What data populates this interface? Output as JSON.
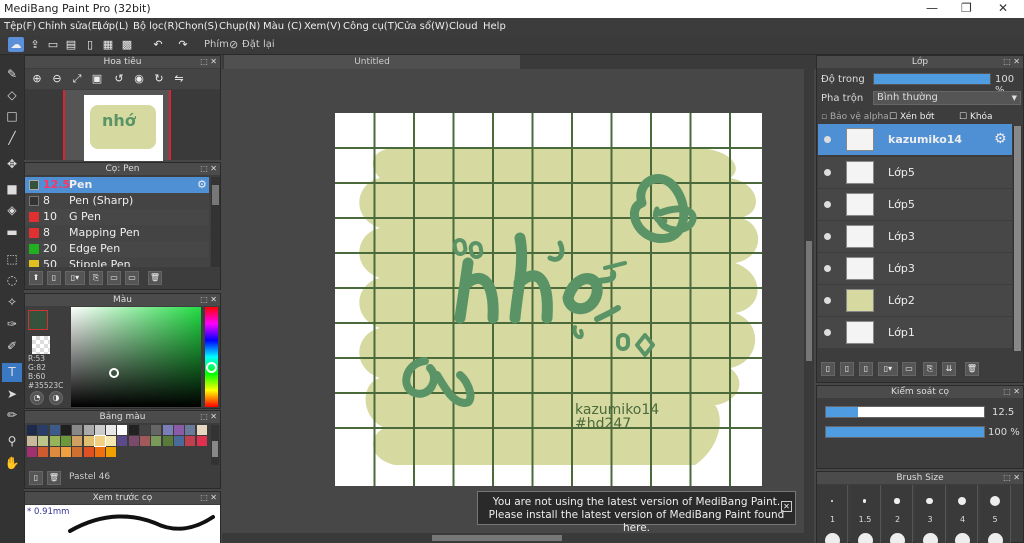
{
  "app": {
    "title": "MediBang Paint Pro (32bit)"
  },
  "menu": [
    "Tệp(F)",
    "Chỉnh sửa(E)",
    "Lớp(L)",
    "Bộ lọc(R)",
    "Chọn(S)",
    "Chụp(N)",
    "Màu (C)",
    "Xem(V)",
    "Công cụ(T)",
    "Cửa sổ(W)",
    "Cloud",
    "Help"
  ],
  "toolbar": {
    "shortcut_label": "Phím",
    "reset_label": "Đặt lại"
  },
  "navigator": {
    "title": "Hoa tiêu"
  },
  "brush": {
    "title": "Cọ: Pen",
    "items": [
      {
        "size": "12.5",
        "name": "Pen",
        "color": "#35523C",
        "selected": true
      },
      {
        "size": "8",
        "name": "Pen (Sharp)",
        "color": "#333333"
      },
      {
        "size": "10",
        "name": "G Pen",
        "color": "#e03030"
      },
      {
        "size": "8",
        "name": "Mapping Pen",
        "color": "#e03030"
      },
      {
        "size": "20",
        "name": "Edge Pen",
        "color": "#20b020"
      },
      {
        "size": "50",
        "name": "Stipple Pen",
        "color": "#e0c020"
      }
    ]
  },
  "color": {
    "title": "Màu",
    "r": "R:53",
    "g": "G:82",
    "b": "B:60",
    "hex": "#35523C",
    "current": "#35523C"
  },
  "palette": {
    "title": "Bảng màu",
    "name": "Pastel 46"
  },
  "brush_preview": {
    "title": "Xem trước cọ",
    "size": "0.91mm"
  },
  "canvas": {
    "tab": "Untitled",
    "bg_color": "#d6d9a0",
    "grid_color": "#4a6a3c",
    "ink": "#5a9466",
    "text_main": "nhớ",
    "text_credit1": "kazumiko14",
    "text_credit2": "#hd247"
  },
  "notification": {
    "line1": "You are not using the latest version of MediBang Paint.",
    "line2": "Please install the latest version of MediBang Paint found here."
  },
  "layers": {
    "title": "Lớp",
    "opacity_label": "Độ trong",
    "opacity_value": "100 %",
    "blend_label": "Pha trộn",
    "blend_value": "Bình thường",
    "protect_alpha": "Bảo vệ alpha",
    "clip": "Xén bớt",
    "lock": "Khóa",
    "items": [
      "kazumiko14",
      "Lớp5",
      "Lớp5",
      "Lớp3",
      "Lớp3",
      "Lớp2",
      "Lớp1"
    ]
  },
  "brush_control": {
    "title": "Kiểm soát cọ",
    "size_value": "12.5",
    "opacity_value": "100 %",
    "size_fill": 0.2,
    "opacity_fill": 1.0
  },
  "brush_size": {
    "title": "Brush Size",
    "sizes": [
      "1",
      "1.5",
      "2",
      "3",
      "4",
      "5"
    ]
  }
}
